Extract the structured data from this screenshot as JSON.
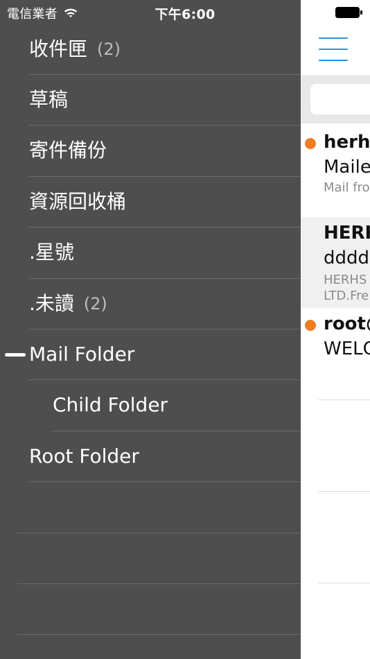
{
  "status_bar": {
    "carrier": "電信業者",
    "time": "下午6:00"
  },
  "drawer": {
    "folders": [
      {
        "label": "收件匣",
        "count": "(2)"
      },
      {
        "label": "草稿",
        "count": ""
      },
      {
        "label": "寄件備份",
        "count": ""
      },
      {
        "label": "資源回收桶",
        "count": ""
      },
      {
        "label": ".星號",
        "count": ""
      },
      {
        "label": ".未讀",
        "count": "(2)"
      },
      {
        "label": "Mail Folder",
        "count": ""
      },
      {
        "label": "Child Folder",
        "count": ""
      },
      {
        "label": "Root Folder",
        "count": ""
      }
    ],
    "active_folder": "Mail Folder"
  },
  "main": {
    "search": {
      "placeholder": "",
      "value": ""
    },
    "emails": [
      {
        "sender": "herhs",
        "subject": "Maile",
        "preview_lines": [
          "Mail fro"
        ],
        "unread": true
      },
      {
        "sender": "HERH",
        "subject": "dddd",
        "preview_lines": [
          "HERHS",
          "LTD.Fre"
        ],
        "unread": false
      },
      {
        "sender": "root@",
        "subject": "WELC",
        "preview_lines": [],
        "unread": true
      }
    ]
  },
  "colors": {
    "drawer_bg": "#4e4e4e",
    "accent_blue": "#2f8ee0",
    "unread_orange": "#ef7d22"
  },
  "icons": {
    "wifi": "wifi-icon",
    "battery": "battery-icon",
    "menu": "menu-icon"
  }
}
